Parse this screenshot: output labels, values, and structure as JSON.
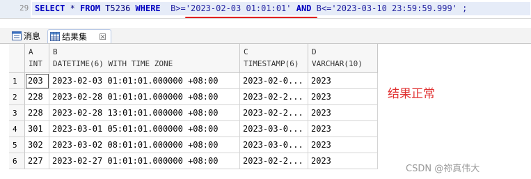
{
  "editor": {
    "line_number": "29",
    "tokens": [
      {
        "t": "SELECT",
        "c": "kw"
      },
      {
        "t": " * ",
        "c": "plain"
      },
      {
        "t": "FROM",
        "c": "kw"
      },
      {
        "t": " T5236 ",
        "c": "plain"
      },
      {
        "t": "WHERE",
        "c": "kw"
      },
      {
        "t": "  B>='2023-02-03 01:01:01' ",
        "c": "str"
      },
      {
        "t": "AND",
        "c": "kw"
      },
      {
        "t": " B<='2023-03-10 23:59:59.999' ;",
        "c": "str"
      }
    ]
  },
  "tabs": {
    "messages_label": "消息",
    "results_label": "结果集",
    "close_glyph": "☒"
  },
  "grid": {
    "columns": [
      {
        "letter": "A",
        "type": "INT"
      },
      {
        "letter": "B",
        "type": "DATETIME(6)  WITH TIME ZONE"
      },
      {
        "letter": "C",
        "type": "TIMESTAMP(6)"
      },
      {
        "letter": "D",
        "type": "VARCHAR(10)"
      }
    ],
    "rows": [
      {
        "n": "1",
        "a": "203",
        "b": "2023-02-03 01:01:01.000000 +08:00",
        "c": "2023-02-0...",
        "d": "2023"
      },
      {
        "n": "2",
        "a": "228",
        "b": "2023-02-28 01:01:01.000000 +08:00",
        "c": "2023-02-2...",
        "d": "2023"
      },
      {
        "n": "3",
        "a": "228",
        "b": "2023-02-28 13:01:01.000000 +08:00",
        "c": "2023-02-2...",
        "d": "2023"
      },
      {
        "n": "4",
        "a": "301",
        "b": "2023-03-01 05:01:01.000000 +08:00",
        "c": "2023-03-0...",
        "d": "2023"
      },
      {
        "n": "5",
        "a": "302",
        "b": "2023-03-02 08:01:01.000000 +08:00",
        "c": "2023-03-0...",
        "d": "2023"
      },
      {
        "n": "6",
        "a": "227",
        "b": "2023-02-27 01:01:01.000000 +08:00",
        "c": "2023-02-2...",
        "d": "2023"
      }
    ]
  },
  "annotation": "结果正常",
  "watermark": "CSDN @祢真伟大",
  "colors": {
    "accent": "#e02020",
    "keyword": "#0000c0"
  }
}
